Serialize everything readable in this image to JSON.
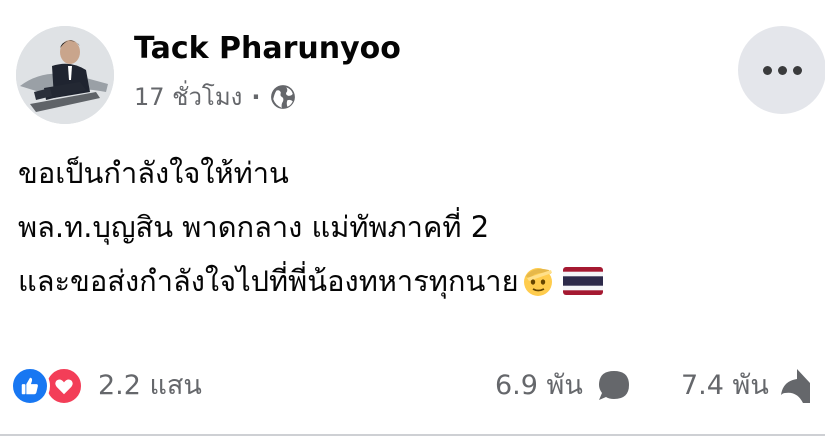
{
  "post": {
    "author": "Tack Pharunyoo",
    "time": "17 ชั่วโมง",
    "separator": "·",
    "privacy_icon": "globe-icon",
    "more_icon": "more-horizontal-icon",
    "message_lines": [
      "ขอเป็นกำลังใจให้ท่าน",
      "พล.ท.บุญสิน พาดกลาง แม่ทัพภาคที่ 2",
      "และขอส่งกำลังใจไปที่พี่น้องทหารทุกนาย"
    ],
    "message_emojis": [
      "saluting-face-emoji",
      "thailand-flag-emoji"
    ]
  },
  "stats": {
    "reaction_icons": [
      "like-icon",
      "love-icon"
    ],
    "reactions_count": "2.2 แสน",
    "comments_count": "6.9 พัน",
    "comment_icon": "comment-icon",
    "shares_count": "7.4 พัน",
    "share_icon": "share-icon"
  },
  "colors": {
    "like": "#1877f2",
    "love": "#f33e58",
    "secondary_text": "#65676b",
    "button_bg": "#e4e6eb"
  }
}
